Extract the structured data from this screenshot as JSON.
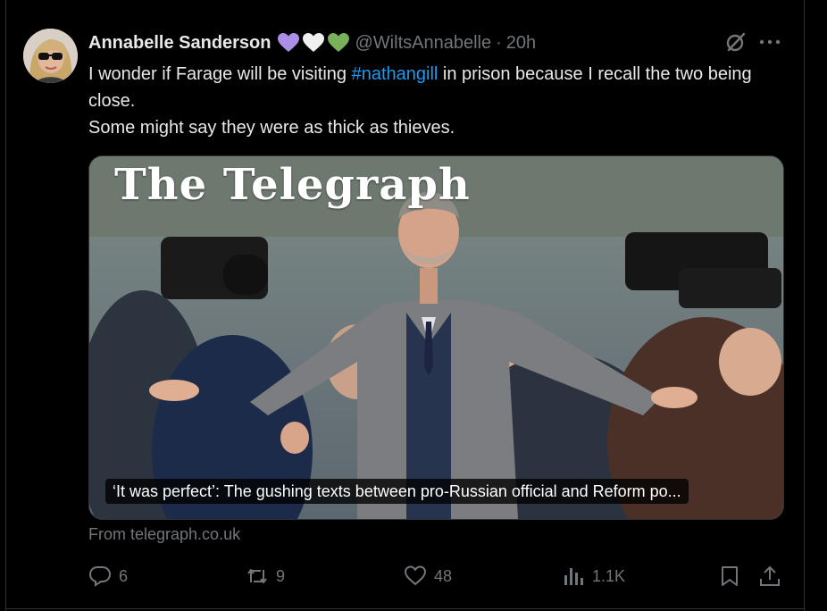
{
  "tweet": {
    "author_name": "Annabelle Sanderson",
    "handle": "@WiltsAnnabelle",
    "separator": "·",
    "time": "20h",
    "hearts": [
      "purple-heart",
      "white-heart",
      "green-heart"
    ],
    "text_line1_pre": "I wonder if Farage will be visiting ",
    "hashtag": "#nathangill",
    "text_line1_post": " in prison because I recall the two being close.",
    "text_line2": "Some might say they were as thick as thieves."
  },
  "card": {
    "masthead": "The Telegraph",
    "caption": "‘It was perfect’: The gushing texts between pro-Russian official and Reform po...",
    "source": "From telegraph.co.uk"
  },
  "actions": {
    "replies": "6",
    "reposts": "9",
    "likes": "48",
    "views": "1.1K"
  },
  "colors": {
    "background": "#000000",
    "text": "#e7e9ea",
    "muted": "#71767b",
    "link": "#1d9bf0",
    "heart_purple": "#ab8ee8",
    "heart_white": "#f0f0f0",
    "heart_green": "#78b159"
  }
}
